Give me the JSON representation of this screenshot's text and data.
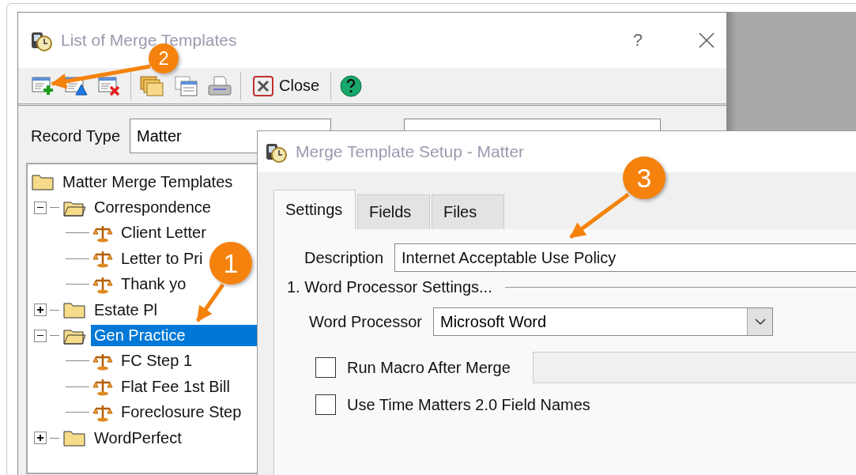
{
  "main_window": {
    "title": "List of Merge Templates",
    "help": "?",
    "toolbar": [
      {
        "kind": "add"
      },
      {
        "kind": "edit"
      },
      {
        "kind": "delete"
      },
      {
        "kind": "separator"
      },
      {
        "kind": "folders"
      },
      {
        "kind": "list"
      },
      {
        "kind": "print"
      },
      {
        "kind": "separator"
      },
      {
        "kind": "close",
        "label": "Close"
      },
      {
        "kind": "separator"
      },
      {
        "kind": "help"
      }
    ],
    "record_type": {
      "label": "Record Type",
      "value": "Matter"
    },
    "tree": [
      {
        "label": "Matter Merge Templates",
        "kind": "folder",
        "selected": false,
        "children": [
          {
            "label": "Correspondence",
            "kind": "folder",
            "expanded": true,
            "selected": false,
            "children": [
              {
                "label": "Client Letter",
                "kind": "template",
                "selected": false
              },
              {
                "label": "Letter to Pri",
                "kind": "template",
                "selected": false
              },
              {
                "label": "Thank yo",
                "kind": "template",
                "selected": false
              }
            ]
          },
          {
            "label": "Estate Pl",
            "kind": "folder",
            "expanded": false,
            "selected": false
          },
          {
            "label": "Gen Practice",
            "kind": "folder",
            "expanded": true,
            "selected": true,
            "children": [
              {
                "label": "FC Step 1",
                "kind": "template",
                "selected": false
              },
              {
                "label": "Flat Fee 1st Bill",
                "kind": "template",
                "selected": false
              },
              {
                "label": "Foreclosure Step",
                "kind": "template",
                "selected": false
              }
            ]
          },
          {
            "label": "WordPerfect",
            "kind": "folder",
            "expanded": false,
            "selected": false
          }
        ]
      }
    ]
  },
  "dialog": {
    "title": "Merge Template Setup - Matter",
    "tabs": [
      {
        "label": "Settings",
        "selected": true
      },
      {
        "label": "Fields",
        "selected": false
      },
      {
        "label": "Files",
        "selected": false
      }
    ],
    "description": {
      "label": "Description",
      "value": "Internet Acceptable Use Policy"
    },
    "section": "1. Word Processor Settings...",
    "word_processor": {
      "label": "Word Processor",
      "value": "Microsoft Word"
    },
    "options": [
      {
        "label": "Run Macro After Merge",
        "checked": false,
        "has_field": true
      },
      {
        "label": "Use Time Matters 2.0 Field Names",
        "checked": false
      }
    ]
  },
  "callouts": [
    {
      "number": "1"
    },
    {
      "number": "2"
    },
    {
      "number": "3"
    }
  ]
}
